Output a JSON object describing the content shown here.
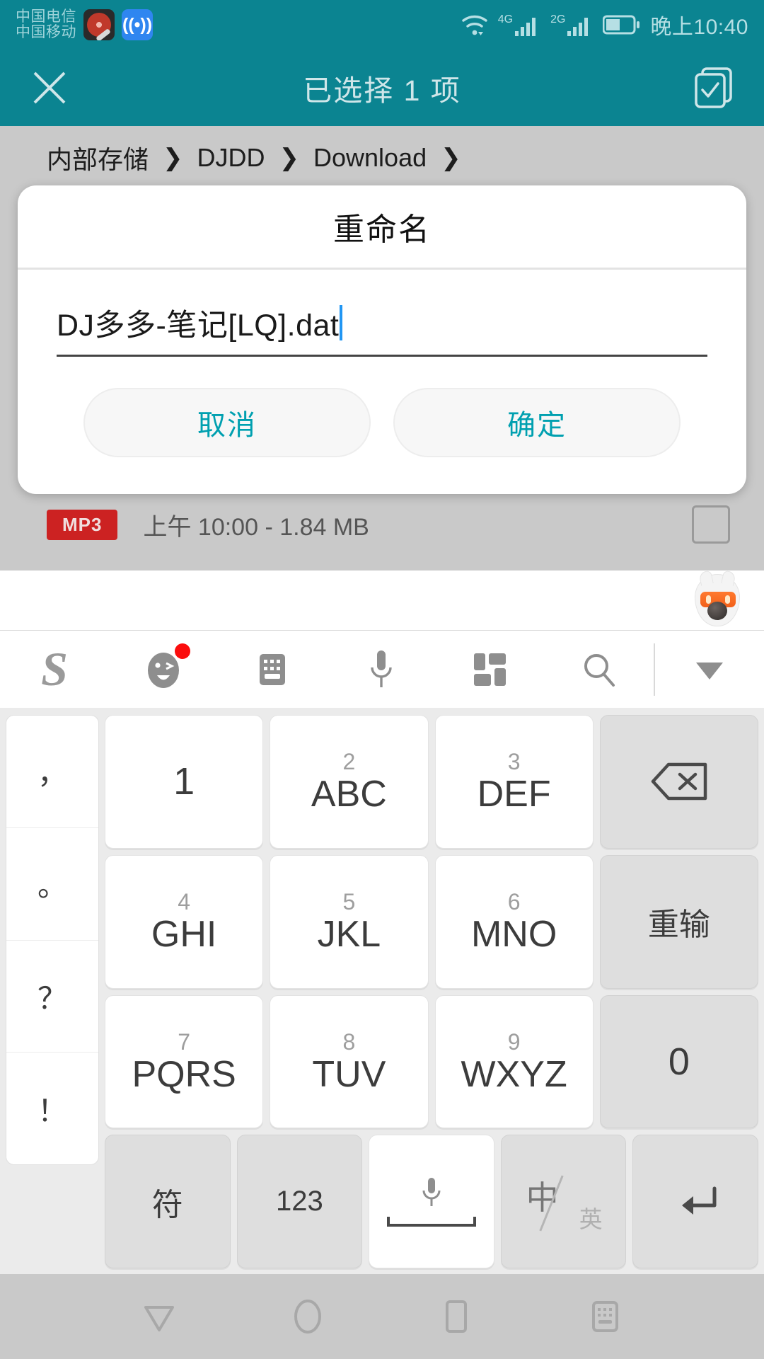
{
  "status_bar": {
    "carriers": [
      "中国电信",
      "中国移动"
    ],
    "icons": [
      "dj-turntable-icon",
      "wifi-share-icon"
    ],
    "network_labels": [
      "4G",
      "2G"
    ],
    "time": "晚上10:40",
    "text_color": "#b6dfe4",
    "background": "#0b8491"
  },
  "app_bar": {
    "close_label": "×",
    "title": "已选择 1 项",
    "select_all_label": "select-all",
    "background": "#0b8491",
    "text_color": "#cfe6e9"
  },
  "breadcrumb": {
    "items": [
      "内部存储",
      "DJDD",
      "Download"
    ],
    "separator": "❯"
  },
  "file_row": {
    "badge": "MP3",
    "badge_color": "#cc2222",
    "meta": "上午 10:00 - 1.84 MB"
  },
  "dialog": {
    "title": "重命名",
    "input_value": "DJ多多-笔记[LQ].dat",
    "caret_color": "#2196f3",
    "cancel_label": "取消",
    "confirm_label": "确定",
    "accent_color": "#00a0b0"
  },
  "ime": {
    "mascot": "sogou-fox-mascot",
    "toolbar": [
      {
        "name": "sogou-logo-icon",
        "glyph": "S",
        "badge": false
      },
      {
        "name": "emoji-icon",
        "glyph": "emoji",
        "badge": true
      },
      {
        "name": "keyboard-icon",
        "glyph": "keyboard",
        "badge": false
      },
      {
        "name": "microphone-icon",
        "glyph": "mic",
        "badge": false
      },
      {
        "name": "grid-panel-icon",
        "glyph": "grid",
        "badge": false
      },
      {
        "name": "search-icon",
        "glyph": "search",
        "badge": false
      },
      {
        "name": "collapse-icon",
        "glyph": "chevron-down",
        "badge": false
      }
    ]
  },
  "keyboard": {
    "punctuation": [
      "，",
      "。",
      "？",
      "！"
    ],
    "rows": [
      [
        {
          "num": "",
          "alpha": "1",
          "type": "white"
        },
        {
          "num": "2",
          "alpha": "ABC",
          "type": "white"
        },
        {
          "num": "3",
          "alpha": "DEF",
          "type": "white"
        },
        {
          "num": "",
          "alpha": "backspace-icon",
          "type": "gray-icon"
        }
      ],
      [
        {
          "num": "4",
          "alpha": "GHI",
          "type": "white"
        },
        {
          "num": "5",
          "alpha": "JKL",
          "type": "white"
        },
        {
          "num": "6",
          "alpha": "MNO",
          "type": "white"
        },
        {
          "num": "",
          "alpha": "重输",
          "type": "gray-cn"
        }
      ],
      [
        {
          "num": "7",
          "alpha": "PQRS",
          "type": "white"
        },
        {
          "num": "8",
          "alpha": "TUV",
          "type": "white"
        },
        {
          "num": "9",
          "alpha": "WXYZ",
          "type": "white"
        },
        {
          "num": "",
          "alpha": "0",
          "type": "gray"
        }
      ]
    ],
    "bottom_row": [
      {
        "label": "符",
        "type": "gray"
      },
      {
        "label": "123",
        "type": "gray"
      },
      {
        "label": "space-mic-key",
        "type": "white"
      },
      {
        "label": "中/英",
        "type": "gray",
        "zh": "中",
        "en": "英"
      },
      {
        "label": "enter-icon",
        "type": "gray"
      }
    ]
  },
  "nav_bar": {
    "buttons": [
      "back-icon",
      "home-icon",
      "recents-icon",
      "hide-keyboard-icon"
    ]
  }
}
